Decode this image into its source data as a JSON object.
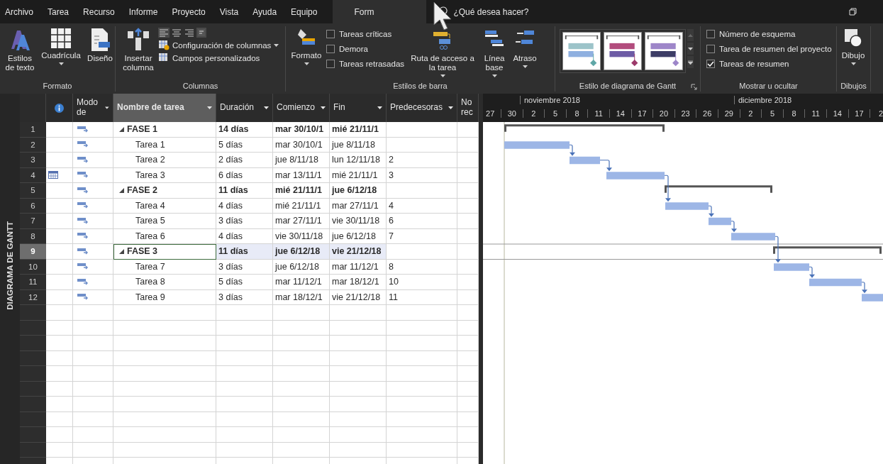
{
  "menu": {
    "tabs": [
      {
        "label": "Archivo",
        "selected": false
      },
      {
        "label": "Tarea",
        "selected": false
      },
      {
        "label": "Recurso",
        "selected": false
      },
      {
        "label": "Informe",
        "selected": false
      },
      {
        "label": "Proyecto",
        "selected": false
      },
      {
        "label": "Vista",
        "selected": false
      },
      {
        "label": "Ayuda",
        "selected": false
      },
      {
        "label": "Equipo",
        "selected": false
      },
      {
        "label": "Form",
        "selected": true
      }
    ],
    "search": {
      "placeholder": "¿Qué desea hacer?"
    }
  },
  "ribbon": {
    "formato": {
      "label": "Formato",
      "buttons": [
        {
          "label": "Estilos de texto",
          "dropdown": false
        },
        {
          "label": "Cuadrícula",
          "dropdown": true
        },
        {
          "label": "Diseño",
          "dropdown": false
        }
      ]
    },
    "columnas": {
      "label": "Columnas",
      "insert": {
        "label": "Insertar columna"
      },
      "commands": [
        {
          "label": "Configuración de columnas",
          "dropdown": true
        },
        {
          "label": "Campos personalizados",
          "dropdown": false
        }
      ]
    },
    "estilos_barra": {
      "label": "Estilos de barra",
      "format": {
        "label": "Formato",
        "dropdown": true
      },
      "checkboxes": [
        {
          "label": "Tareas críticas",
          "checked": false
        },
        {
          "label": "Demora",
          "checked": false
        },
        {
          "label": "Tareas retrasadas",
          "checked": false
        }
      ],
      "buttons": [
        {
          "label": "Ruta de acceso a la tarea",
          "dropdown": true
        },
        {
          "label": "Línea base",
          "dropdown": true
        },
        {
          "label": "Atraso",
          "dropdown": true
        }
      ]
    },
    "estilo_gantt": {
      "label": "Estilo de diagrama de Gantt"
    },
    "mostrar": {
      "label": "Mostrar u ocultar",
      "checkboxes": [
        {
          "label": "Número de esquema",
          "checked": false
        },
        {
          "label": "Tarea de resumen del proyecto",
          "checked": false
        },
        {
          "label": "Tareas de resumen",
          "checked": true
        }
      ]
    },
    "dibujos": {
      "label": "Dibujos",
      "button": {
        "label": "Dibujo",
        "dropdown": true
      }
    }
  },
  "view_bar": {
    "label": "DIAGRAMA DE GANTT"
  },
  "table": {
    "columns": [
      {
        "label": "Modo de",
        "dropdown": true,
        "selected": false
      },
      {
        "label": "Nombre de tarea",
        "dropdown": true,
        "selected": true
      },
      {
        "label": "Duración",
        "dropdown": true,
        "selected": false
      },
      {
        "label": "Comienzo",
        "dropdown": true,
        "selected": false
      },
      {
        "label": "Fin",
        "dropdown": true,
        "selected": false
      },
      {
        "label": "Predecesoras",
        "dropdown": true,
        "selected": false
      },
      {
        "label": "No rec",
        "dropdown": false,
        "selected": false
      }
    ],
    "rows": [
      {
        "id": "1",
        "name": "FASE 1",
        "duration": "14 días",
        "start": "mar 30/10/1",
        "end": "mié 21/11/1",
        "calendar": false,
        "selected": false,
        "expanded": true,
        "children": [
          {
            "id": "2",
            "name": "Tarea 1",
            "duration": "5 días",
            "start": "mar 30/10/1",
            "end": "jue 8/11/18",
            "calendar": false,
            "selected": false
          },
          {
            "id": "3",
            "name": "Tarea 2",
            "duration": "2 días",
            "start": "jue 8/11/18",
            "end": "lun 12/11/18",
            "predecessors": "2",
            "calendar": false,
            "selected": false
          },
          {
            "id": "4",
            "name": "Tarea 3",
            "duration": "6 días",
            "start": "mar 13/11/1",
            "end": "mié 21/11/1",
            "predecessors": "3",
            "calendar": true,
            "selected": false
          }
        ]
      },
      {
        "id": "5",
        "name": "FASE 2",
        "duration": "11 días",
        "start": "mié 21/11/1",
        "end": "jue 6/12/18",
        "calendar": false,
        "selected": false,
        "expanded": true,
        "children": [
          {
            "id": "6",
            "name": "Tarea 4",
            "duration": "4 días",
            "start": "mié 21/11/1",
            "end": "mar 27/11/1",
            "predecessors": "4",
            "calendar": false,
            "selected": false
          },
          {
            "id": "7",
            "name": "Tarea 5",
            "duration": "3 días",
            "start": "mar 27/11/1",
            "end": "vie 30/11/18",
            "predecessors": "6",
            "calendar": false,
            "selected": false
          },
          {
            "id": "8",
            "name": "Tarea 6",
            "duration": "4 días",
            "start": "vie 30/11/18",
            "end": "jue 6/12/18",
            "predecessors": "7",
            "calendar": false,
            "selected": false
          }
        ]
      },
      {
        "id": "9",
        "name": "FASE 3",
        "duration": "11 días",
        "start": "jue 6/12/18",
        "end": "vie 21/12/18",
        "calendar": false,
        "selected": true,
        "expanded": true,
        "children": [
          {
            "id": "10",
            "name": "Tarea 7",
            "duration": "3 días",
            "start": "jue 6/12/18",
            "end": "mar 11/12/1",
            "predecessors": "8",
            "calendar": false,
            "selected": false
          },
          {
            "id": "11",
            "name": "Tarea 8",
            "duration": "5 días",
            "start": "mar 11/12/1",
            "end": "mar 18/12/1",
            "predecessors": "10",
            "calendar": false,
            "selected": false
          },
          {
            "id": "12",
            "name": "Tarea 9",
            "duration": "3 días",
            "start": "mar 18/12/1",
            "end": "vie 21/12/18",
            "predecessors": "11",
            "calendar": false,
            "selected": false
          }
        ]
      }
    ]
  },
  "timeline": {
    "months": [
      {
        "label": "noviembre 2018"
      },
      {
        "label": "diciembre 2018"
      }
    ],
    "days": [
      "27",
      "30",
      "2",
      "5",
      "8",
      "11",
      "14",
      "17",
      "20",
      "23",
      "26",
      "29",
      "2",
      "5",
      "8",
      "11",
      "14",
      "17",
      "2"
    ]
  }
}
